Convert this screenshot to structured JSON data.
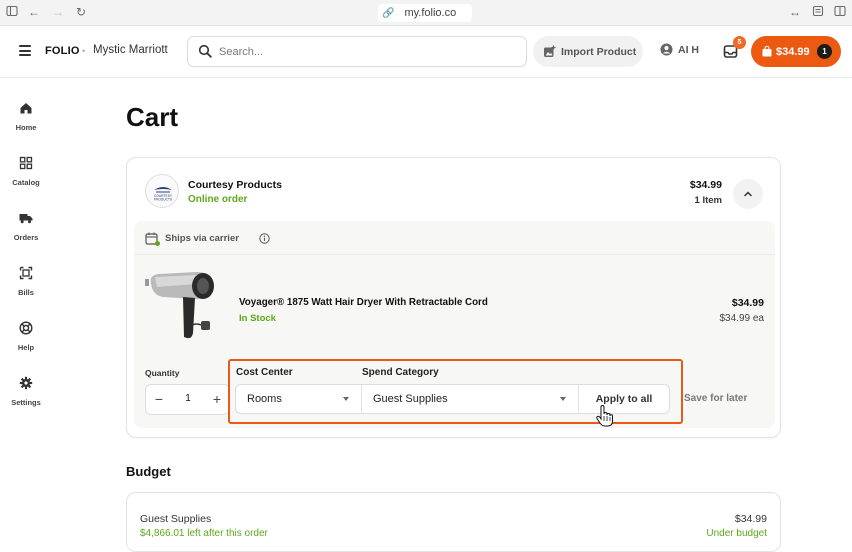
{
  "browser": {
    "url": "my.folio.co"
  },
  "header": {
    "logo": "FOLIO",
    "property": "Mystic Marriott",
    "search_placeholder": "Search...",
    "import_label": "Import Product",
    "user_label": "AI H",
    "inbox_count": "5",
    "cart_total": "$34.99",
    "cart_count": "1"
  },
  "sidebar": {
    "items": [
      {
        "label": "Home",
        "icon": "home-icon"
      },
      {
        "label": "Catalog",
        "icon": "grid-icon"
      },
      {
        "label": "Orders",
        "icon": "truck-icon"
      },
      {
        "label": "Bills",
        "icon": "receipt-icon"
      },
      {
        "label": "Help",
        "icon": "lifebuoy-icon"
      },
      {
        "label": "Settings",
        "icon": "gear-icon"
      }
    ]
  },
  "page": {
    "title": "Cart"
  },
  "vendor": {
    "name": "Courtesy Products",
    "order_type": "Online order",
    "total": "$34.99",
    "item_count": "1 Item",
    "shipping_label": "Ships via carrier"
  },
  "product": {
    "name": "Voyager® 1875 Watt Hair Dryer With Retractable Cord",
    "stock": "In Stock",
    "price": "$34.99",
    "unit_price": "$34.99 ea"
  },
  "line_controls": {
    "quantity_label": "Quantity",
    "quantity_value": "1",
    "cost_center_label": "Cost Center",
    "cost_center_value": "Rooms",
    "spend_category_label": "Spend Category",
    "spend_category_value": "Guest Supplies",
    "apply_label": "Apply to all",
    "save_later_label": "Save for later"
  },
  "budget": {
    "title": "Budget",
    "name": "Guest Supplies",
    "amount": "$34.99",
    "remaining": "$4,866.01 left after this order",
    "status": "Under budget"
  },
  "colors": {
    "accent": "#ec5a12",
    "success": "#5ea81a",
    "highlight": "#e85a1a"
  }
}
